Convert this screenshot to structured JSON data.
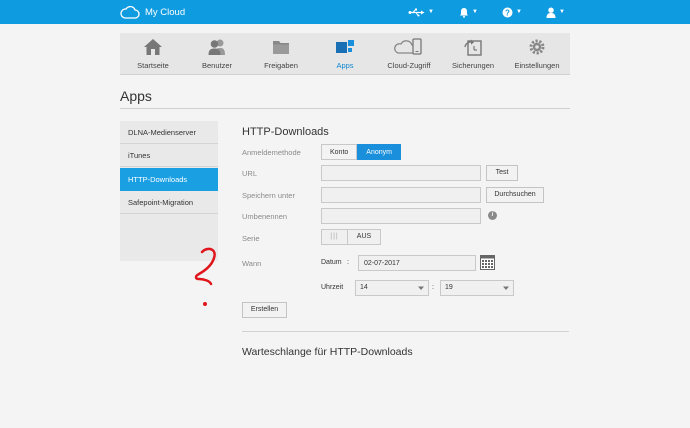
{
  "topbar": {
    "brand": "My Cloud",
    "icons": [
      "usb-icon",
      "bell-icon",
      "help-icon",
      "user-icon"
    ]
  },
  "nav": {
    "items": [
      {
        "label": "Startseite",
        "icon": "home-icon"
      },
      {
        "label": "Benutzer",
        "icon": "users-icon"
      },
      {
        "label": "Freigaben",
        "icon": "folder-icon"
      },
      {
        "label": "Apps",
        "icon": "apps-icon",
        "active": true
      },
      {
        "label": "Cloud-Zugriff",
        "icon": "cloud-device-icon"
      },
      {
        "label": "Sicherungen",
        "icon": "backup-icon"
      },
      {
        "label": "Einstellungen",
        "icon": "gear-icon"
      }
    ]
  },
  "page": {
    "title": "Apps"
  },
  "sidebar": {
    "items": [
      {
        "label": "DLNA-Medienserver"
      },
      {
        "label": "iTunes"
      },
      {
        "label": "HTTP-Downloads",
        "active": true
      },
      {
        "label": "Safepoint-Migration"
      }
    ]
  },
  "form": {
    "heading": "HTTP-Downloads",
    "login_label": "Anmeldemethode",
    "login_options": [
      "Konto",
      "Anonym"
    ],
    "login_selected": "Anonym",
    "url_label": "URL",
    "url_value": "",
    "test_button": "Test",
    "save_label": "Speichern unter",
    "save_value": "",
    "browse_button": "Durchsuchen",
    "rename_label": "Umbenennen",
    "rename_value": "",
    "series_label": "Serie",
    "series_toggle_knob": "|||",
    "series_value": "AUS",
    "when_label": "Wann",
    "date_label": "Datum",
    "date_colon": ":",
    "date_value": "02-07-2017",
    "time_label": "Uhrzeit",
    "time_colon": ":",
    "hour": "14",
    "minute": "19",
    "create_button": "Erstellen"
  },
  "queue": {
    "heading": "Warteschlange für HTTP-Downloads"
  },
  "colors": {
    "accent": "#0f9be0",
    "active_item": "#1a9fe3",
    "annotation": "#e0151b"
  }
}
